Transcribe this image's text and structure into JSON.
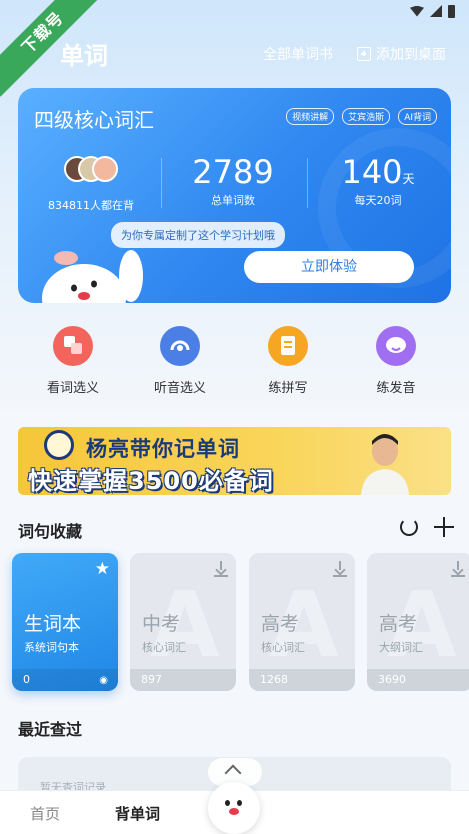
{
  "watermark": "下载号",
  "header": {
    "title": "单词",
    "all_words": "全部单词书",
    "add_desktop": "添加到桌面"
  },
  "card": {
    "title": "四级核心词汇",
    "tags": [
      "视频讲解",
      "艾宾浩斯",
      "AI背词"
    ],
    "learners": "834811人都在背",
    "total_words": "2789",
    "total_words_label": "总单词数",
    "days": "140",
    "days_unit": "天",
    "daily_label": "每天20词",
    "plan_bubble": "为你专属定制了这个学习计划哦",
    "try_button": "立即体验"
  },
  "modes": [
    {
      "label": "看词选义",
      "color": "#f2645c"
    },
    {
      "label": "听音选义",
      "color": "#4c7fe6"
    },
    {
      "label": "练拼写",
      "color": "#f6a623"
    },
    {
      "label": "练发音",
      "color": "#a06ef0"
    }
  ],
  "banner": {
    "line1": "杨亮带你记单词",
    "line2": "快速掌握3500必备词"
  },
  "collection": {
    "title": "词句收藏",
    "books": [
      {
        "name": "生词本",
        "sub": "系统词句本",
        "count": "0"
      },
      {
        "name": "中考",
        "sub": "核心词汇",
        "count": "897"
      },
      {
        "name": "高考",
        "sub": "核心词汇",
        "count": "1268"
      },
      {
        "name": "高考",
        "sub": "大纲词汇",
        "count": "3690"
      }
    ]
  },
  "recent": {
    "title": "最近查过",
    "hint": "暂无查词记录"
  },
  "nav": {
    "home": "首页",
    "words": "背单词"
  }
}
